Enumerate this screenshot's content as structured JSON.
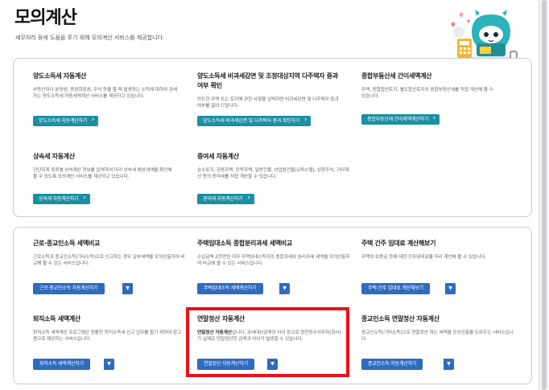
{
  "page": {
    "title": "모의계산",
    "description": "세무처리 등에 도움을 주기 위해 모의계산 서비스를 제공합니다."
  },
  "group1": [
    {
      "title": "양도소득세 자동계산",
      "desc": "부동산이나 분양권, 증권회원권, 주식 등을 팔 때 발생하는 소득에 대하여 과세하는 양도소득세 자동세액계산 서비스를 제공하고 있습니다.",
      "button": "양도소득세 자동계산하기"
    },
    {
      "title": "양도소득세 비과세감면 및 조정대상지역 다주택자 중과 여부 확인",
      "desc": "양도한 주택 또는 토지에 관한 사항을 입력하면 비과세감면 및 다주택자 중과 여부를 알려 드립니다.",
      "button": "양도소득세 비과세감면 및 다주택자 중과 확인하기"
    },
    {
      "title": "종합부동산세 간이세액계산",
      "desc": "주택, 종합합산토지, 별도합산토지의 종합부동산세를 직접 계산해 볼 수 있습니다.",
      "button": "종합부동산세 간이세액계산하기"
    },
    {
      "title": "상속세 자동계산",
      "desc": "간단하게 종류별 상속재산 정보를 입력하여 미리 상속세 예상세액을 확인해볼 수 있도록 모의계산 서비스를 제공하고 있습니다.",
      "button": "상속세 자동계산하기"
    },
    {
      "title": "증여세 자동계산",
      "desc": "순수토지, 공동주택, 단독주택, 일반건물, 상업용건물(오피스텔), 상장주식, 기타재산 등의 증여세를 직접 계산할 수 있습니다.",
      "button": "증여세 자동계산하기"
    }
  ],
  "group2": [
    {
      "title": "근로·종교인소득 세액비교",
      "desc": "근로소득과 종교인소득(기타소득)으로 신고하는 경우 납부세액을 모의산출하여 비교해 볼 수 있는 서비스입니다.",
      "button": "근로·종교인소득 자동계산하기"
    },
    {
      "title": "주택임대소득 종합분리과세 세액비교",
      "desc": "수입금액 2천만원 이하 주택임대소득자의 종합과세와 분리과세 세액을 모의산출하여 비교해 볼 수 있는 서비스입니다.",
      "button": "주택임대소득 세액계산하기"
    },
    {
      "title": "주택 간주 임대료 계산해보기",
      "desc": "주택의 보증금 등에 대한 간주임대료를 미리 계산해 볼 수 있습니다.",
      "button": "주택 간주 임대료 계산해보기"
    },
    {
      "title": "퇴직소득 세액계산",
      "desc": "퇴직소득 세액계산 프로그램은 원활한 퇴직소득세 신고 업무를 돕기 위하여 참고용으로 제공하는 서비스입니다.",
      "button": "퇴직소득 세액계산하기"
    },
    {
      "title": "연말정산 자동계산",
      "desc_bold": "연말정산 자동계산",
      "desc": "입니다. 과세대상금액의 차이 등으로 원천징수의무자(회사)가 실제로 연말정산한 금액과 차이가 발생할 수 있습니다.",
      "button": "연말정산 자동계산하기"
    },
    {
      "title": "종교인소득 연말정산 자동계산",
      "desc": "종교인소득(기타소득)으로 연말정산 하는 세액을 모의산출을 도와주는 서비스입니다.",
      "button": "종교인소득 자동계산하기"
    }
  ],
  "colors": {
    "teal": "#1b8fa3",
    "blue": "#2f6bbf",
    "highlight": "#e8121a"
  }
}
